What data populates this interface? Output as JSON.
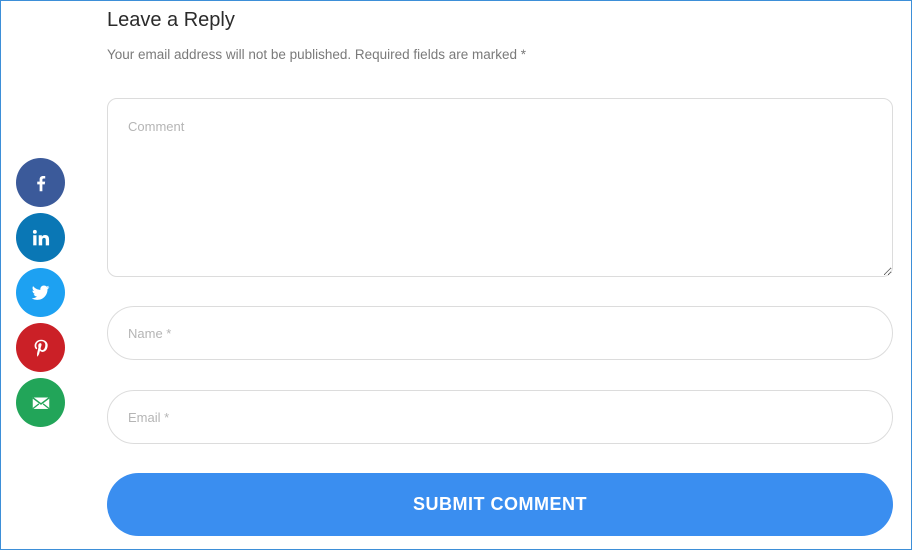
{
  "reply": {
    "title": "Leave a Reply",
    "notice": "Your email address will not be published. Required fields are marked",
    "required_mark": "*"
  },
  "form": {
    "comment_placeholder": "Comment",
    "name_placeholder": "Name *",
    "email_placeholder": "Email *",
    "submit_label": "SUBMIT COMMENT"
  },
  "share_buttons": [
    {
      "icon": "facebook-icon",
      "color": "#3b5a9a"
    },
    {
      "icon": "linkedin-icon",
      "color": "#0a77b5"
    },
    {
      "icon": "twitter-icon",
      "color": "#1da1f2"
    },
    {
      "icon": "pinterest-icon",
      "color": "#cb2027"
    },
    {
      "icon": "email-icon",
      "color": "#22a559"
    }
  ],
  "colors": {
    "accent": "#3a8ef0",
    "border": "#dcdcdc"
  }
}
